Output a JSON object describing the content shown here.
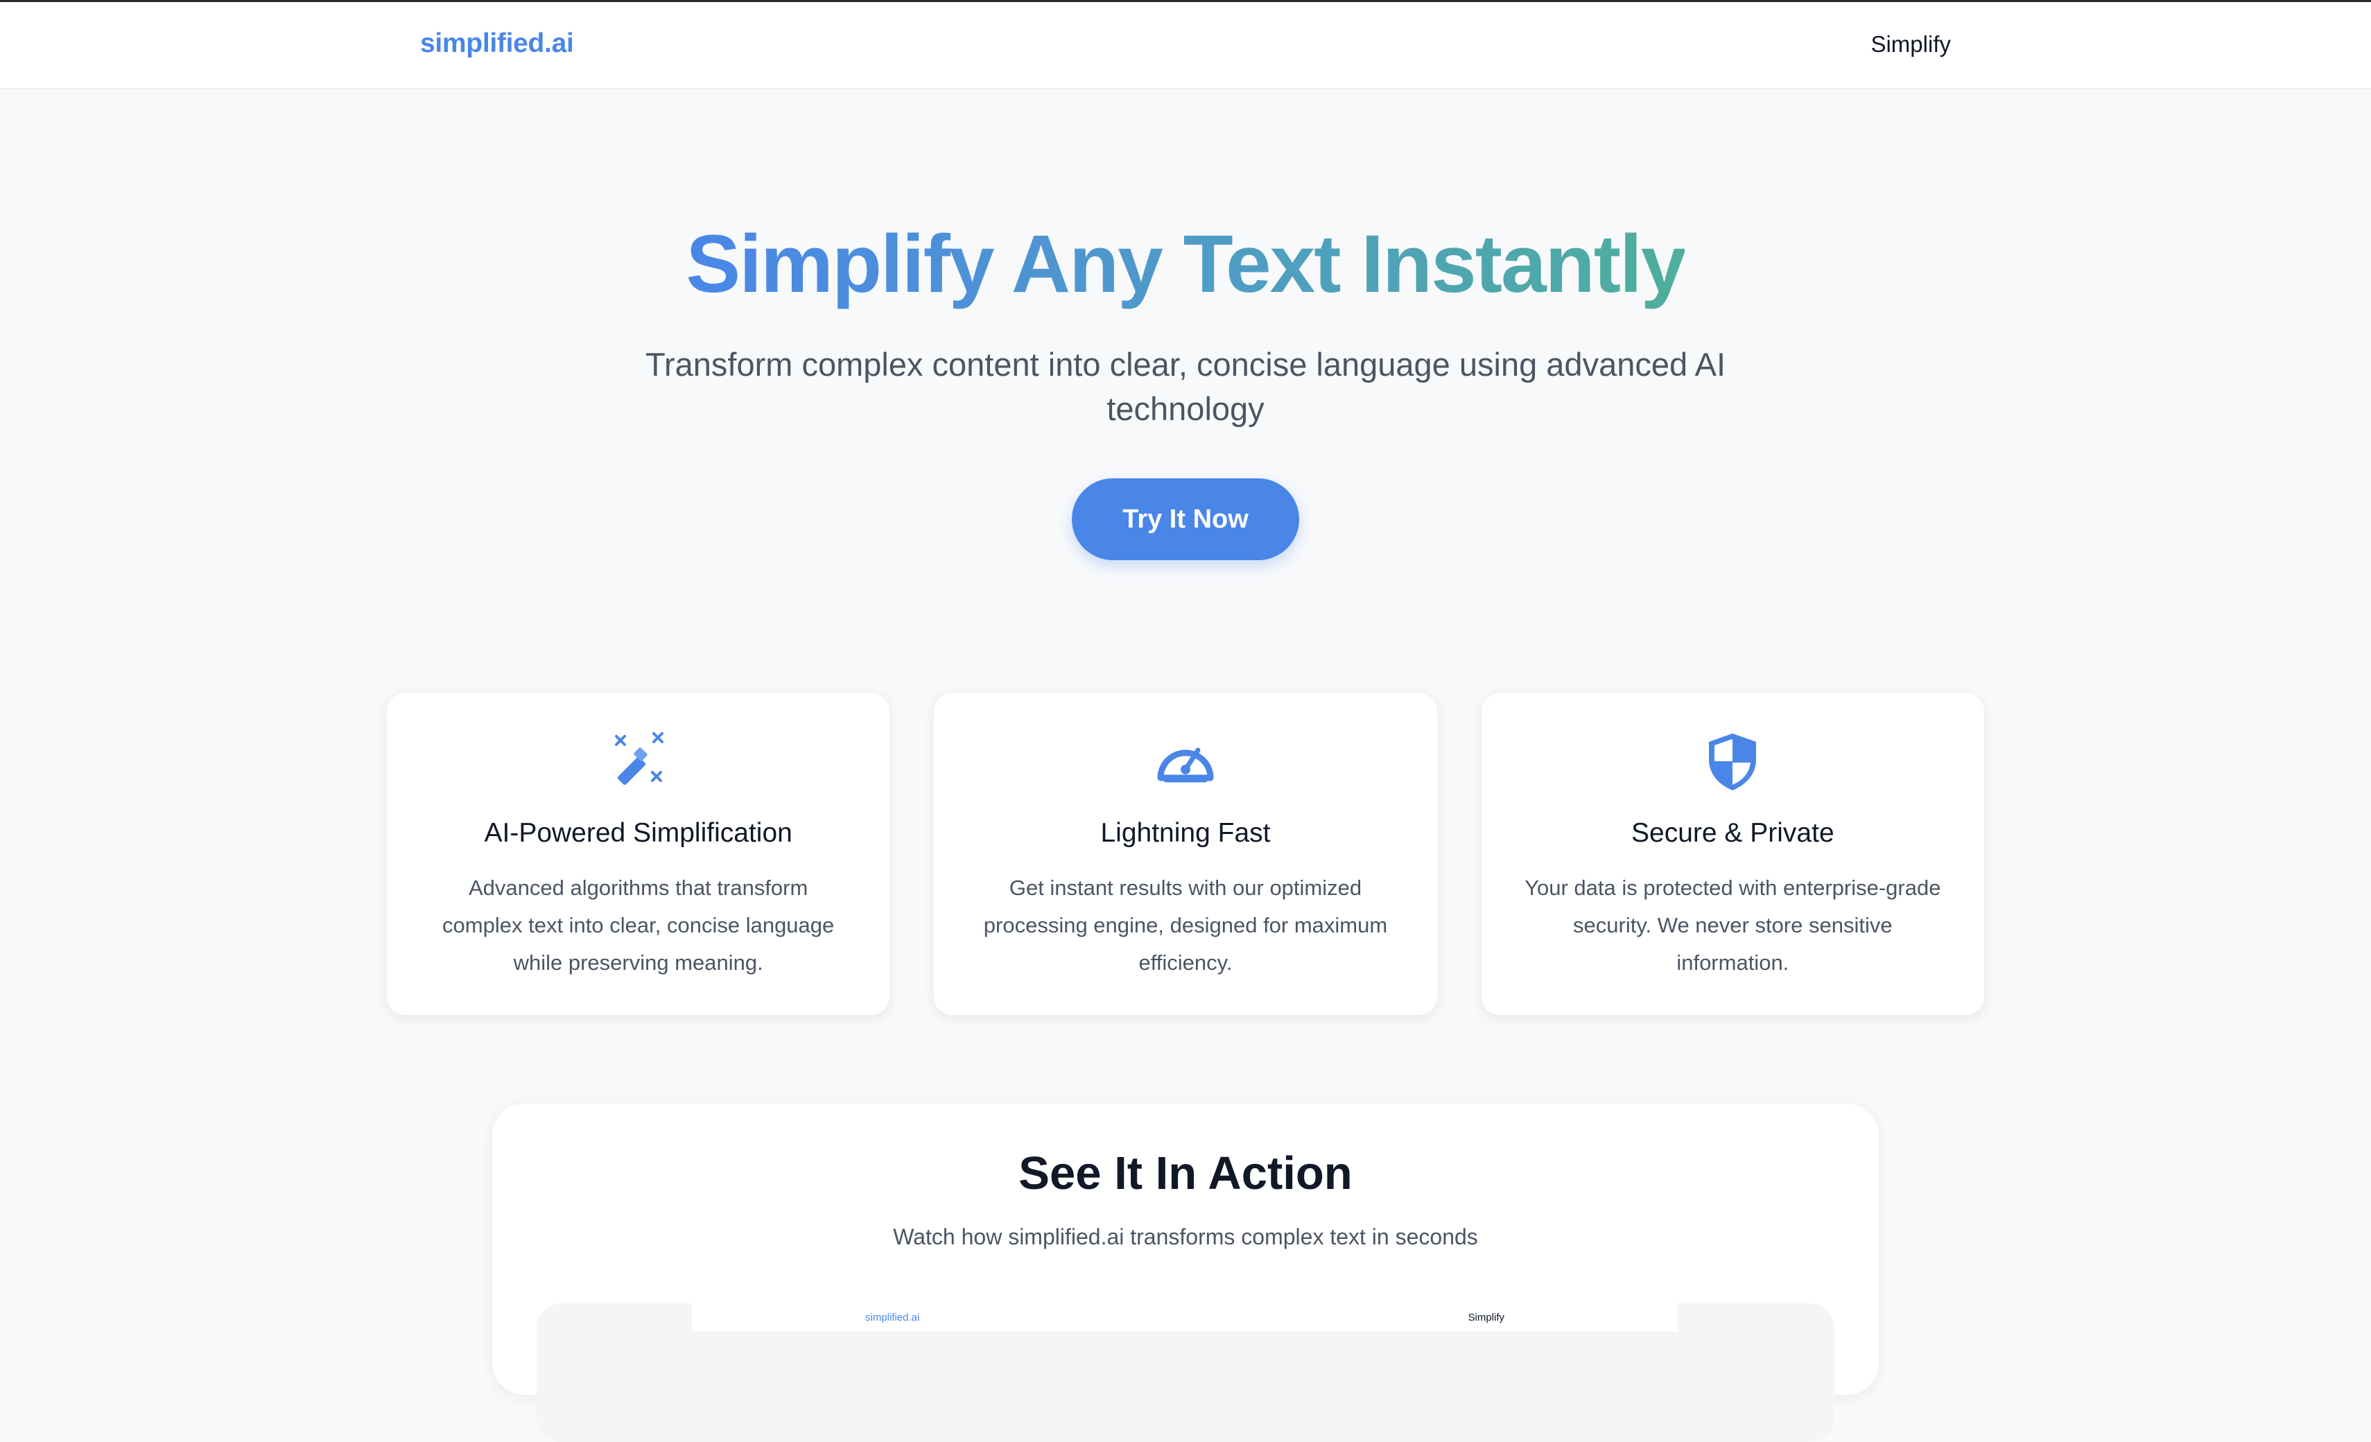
{
  "nav": {
    "logo": "simplified.ai",
    "link": "Simplify"
  },
  "hero": {
    "title": "Simplify Any Text Instantly",
    "subtitle": "Transform complex content into clear, concise language using advanced AI technology",
    "cta": "Try It Now"
  },
  "colors": {
    "accent": "#4a86e8",
    "gradient_end": "#4fae9c"
  },
  "features": [
    {
      "icon": "magic-wand-icon",
      "title": "AI-Powered Simplification",
      "desc": "Advanced algorithms that transform complex text into clear, concise language while preserving meaning."
    },
    {
      "icon": "speedometer-icon",
      "title": "Lightning Fast",
      "desc": "Get instant results with our optimized processing engine, designed for maximum efficiency."
    },
    {
      "icon": "shield-icon",
      "title": "Secure & Private",
      "desc": "Your data is protected with enterprise-grade security. We never store sensitive information."
    }
  ],
  "demo": {
    "title": "See It In Action",
    "subtitle": "Watch how simplified.ai transforms complex text in seconds",
    "preview_logo": "simplified.ai",
    "preview_link": "Simplify"
  }
}
